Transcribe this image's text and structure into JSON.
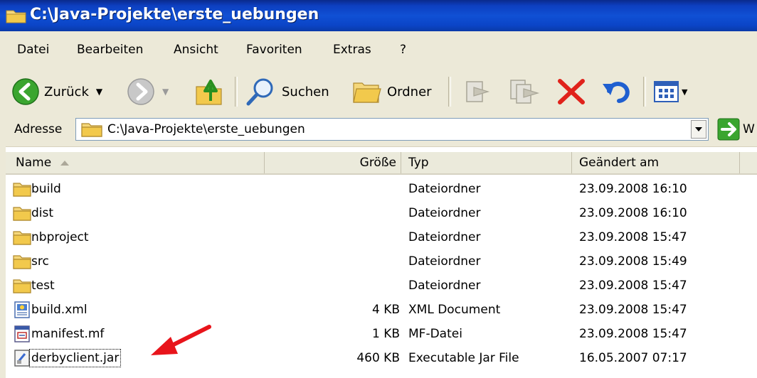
{
  "window": {
    "title": "C:\\Java-Projekte\\erste_uebungen"
  },
  "menu": [
    "Datei",
    "Bearbeiten",
    "Ansicht",
    "Favoriten",
    "Extras",
    "?"
  ],
  "toolbar": {
    "back_label": "Zurück",
    "search_label": "Suchen",
    "folders_label": "Ordner"
  },
  "address": {
    "label": "Adresse",
    "value": "C:\\Java-Projekte\\erste_uebungen",
    "go_label": "W"
  },
  "columns": {
    "name": "Name",
    "size": "Größe",
    "type": "Typ",
    "modified": "Geändert am"
  },
  "files": [
    {
      "name": "build",
      "size": "",
      "type": "Dateiordner",
      "modified": "23.09.2008 16:10",
      "icon": "folder-icon"
    },
    {
      "name": "dist",
      "size": "",
      "type": "Dateiordner",
      "modified": "23.09.2008 16:10",
      "icon": "folder-icon"
    },
    {
      "name": "nbproject",
      "size": "",
      "type": "Dateiordner",
      "modified": "23.09.2008 15:47",
      "icon": "folder-icon"
    },
    {
      "name": "src",
      "size": "",
      "type": "Dateiordner",
      "modified": "23.09.2008 15:49",
      "icon": "folder-icon"
    },
    {
      "name": "test",
      "size": "",
      "type": "Dateiordner",
      "modified": "23.09.2008 15:47",
      "icon": "folder-icon"
    },
    {
      "name": "build.xml",
      "size": "4 KB",
      "type": "XML Document",
      "modified": "23.09.2008 15:47",
      "icon": "xml-file-icon"
    },
    {
      "name": "manifest.mf",
      "size": "1 KB",
      "type": "MF-Datei",
      "modified": "23.09.2008 15:47",
      "icon": "mf-file-icon"
    },
    {
      "name": "derbyclient.jar",
      "size": "460 KB",
      "type": "Executable Jar File",
      "modified": "16.05.2007 07:17",
      "icon": "jar-file-icon"
    }
  ],
  "colors": {
    "title_bar": "#0d3fc0",
    "chrome": "#ece9d8",
    "arrow_annotation": "#e8141b",
    "folder": "#f2c94c"
  }
}
